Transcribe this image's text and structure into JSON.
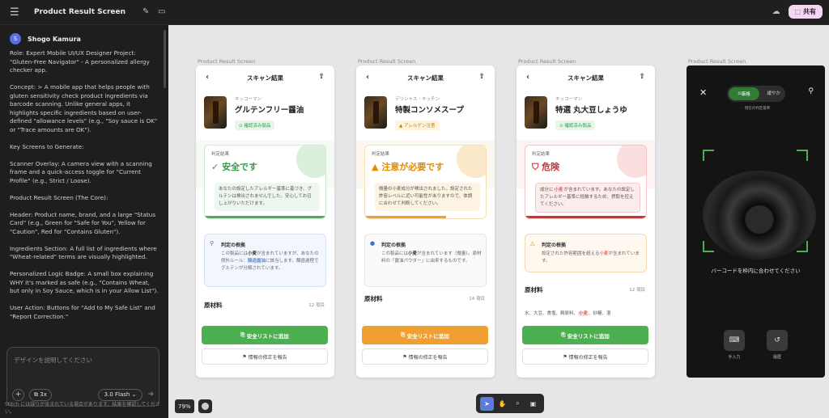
{
  "app": {
    "title": "Product Result Screen",
    "share_label": "共有"
  },
  "user": {
    "initial": "S",
    "name": "Shogo Kamura"
  },
  "chat": [
    "Role: Expert Mobile UI/UX Designer Project: \"Gluten-Free Navigator\" - A personalized allergy checker app.",
    "Concept: > A mobile app that helps people with gluten sensitivity check product ingredients via barcode scanning. Unlike general apps, it highlights specific ingredients based on user-defined \"allowance levels\" (e.g., \"Soy sauce is OK\" or \"Trace amounts are OK\").",
    "Key Screens to Generate:",
    "Scanner Overlay: A camera view with a scanning frame and a quick-access toggle for \"Current Profile\" (e.g., Strict / Loose).",
    "Product Result Screen (The Core):",
    "Header: Product name, brand, and a large \"Status Card\" (e.g., Green for \"Safe for You\", Yellow for \"Caution\", Red for \"Contains Gluten\").",
    "Ingredients Section: A full list of ingredients where \"Wheat-related\" terms are visually highlighted.",
    "Personalized Logic Badge: A small box explaining WHY it's marked as safe (e.g., \"Contains Wheat, but only in Soy Sauce, which is in your Allow List\").",
    "User Action: Buttons for \"Add to My Safe List\" and \"Report Correction.\""
  ],
  "input": {
    "placeholder": "デザインを説明してください",
    "plus": "+",
    "count_chip": "3x",
    "model": "3.0 Flash ⌄",
    "disclaimer": "Stitch には誤りが含まれている場合があります。結果を確認してください。"
  },
  "frames": {
    "label": "Product Result Screen",
    "header_title": "スキャン結果",
    "verdict_label": "判定結果",
    "reason_title": "判定の根拠",
    "ingredients_title": "原材料",
    "add_button": "安全リストに追加",
    "report_button": "情報の修正を報告"
  },
  "products": [
    {
      "brand": "キッコーマン",
      "name": "グルテンフリー醤油",
      "badge": "確認済み製品",
      "verdict": "安全です",
      "verdict_icon": "✓",
      "desc": "あなたの設定したアレルギー基準に基づき、グルテンは検出されませんでした。安心してお召し上がりいただけます。",
      "reason_a": "この製品には",
      "reason_hl": "小麦",
      "reason_b": "が含まれていますが、あなたの例外ルール：",
      "reason_hl2": "醸造醤油",
      "reason_c": "に該当します。醸造過程でグルテンが分解されています。",
      "ingredients_count": "12 項目",
      "ingredients": "",
      "colors": {
        "accent": "#2e9e46",
        "bg": "#e8f6ea",
        "button": "#4caf50"
      }
    },
    {
      "brand": "デリシャス・キッチン",
      "name": "特製コンソメスープ",
      "badge": "アレルゲン注意",
      "verdict": "注意が必要です",
      "verdict_icon": "▲",
      "desc": "微量の小麦成分が検出されました。設定された許容レベルに近い可能性がありますので、体調に合わせて判断してください。",
      "reason_a": "この製品には",
      "reason_hl": "小麦",
      "reason_b": "が含まれています（微量）。原材料の「醤油パウダー」に由来するものです。",
      "reason_hl2": "",
      "reason_c": "",
      "ingredients_count": "14 項目",
      "ingredients": "",
      "colors": {
        "accent": "#e68a00",
        "bg": "#fdf3e3",
        "button": "#f0a030"
      }
    },
    {
      "brand": "キッコーマン",
      "name": "特選 丸大豆しょうゆ",
      "badge": "確認済み製品",
      "verdict": "危険",
      "verdict_icon": "⛉",
      "desc_a": "成分に",
      "desc_hl": "小麦",
      "desc_b": "が含まれています。あなたの設定したアレルギー基準に抵触するため、摂取を控えてください。",
      "reason_a": "設定された許容範囲を超える",
      "reason_hl": "小麦",
      "reason_b": "が含まれています。",
      "ingredients_count": "12 項目",
      "ingredients_a": "水、大豆、食塩、麹原料、",
      "ingredients_hl": "小麦",
      "ingredients_b": "、砂糖、混",
      "colors": {
        "accent": "#d32f2f",
        "bg": "#fdecec",
        "button": "#4caf50"
      }
    }
  ],
  "scanner": {
    "label": "Product Result Screen",
    "toggle_on": "厳格",
    "toggle_off": "緩やか",
    "profile_note": "現在の判定基準",
    "caption": "バーコードを枠内に合わせてください",
    "manual": "手入力",
    "history": "履歴"
  },
  "bottom": {
    "zoom": "79%"
  }
}
